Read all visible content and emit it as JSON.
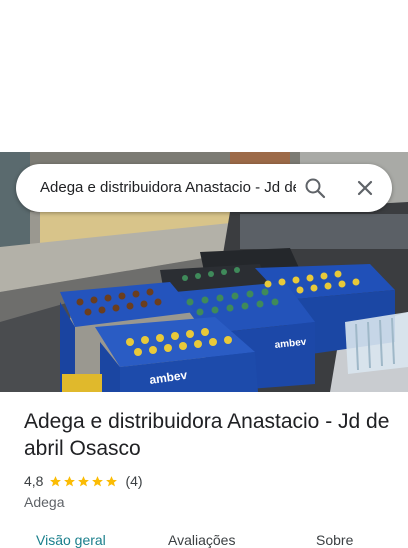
{
  "search": {
    "query": "Adega e distribuidora Anastacio - Jd de abril Osasco",
    "search_icon": "search-icon",
    "close_icon": "close-icon"
  },
  "place": {
    "name": "Adega e distribuidora Anastacio - Jd de abril Osasco",
    "rating": "4,8",
    "rating_value": 4.8,
    "stars_filled": 5,
    "review_count": "(4)",
    "category": "Adega"
  },
  "tabs": [
    {
      "label": "Visão geral",
      "active": true
    },
    {
      "label": "Avaliações",
      "active": false
    },
    {
      "label": "Sobre",
      "active": false
    }
  ],
  "colors": {
    "star": "#fbbc04",
    "active_tab": "#1a7f8c",
    "crate_blue": "#1e4fb5"
  },
  "photo": {
    "crate_brand": "ambev"
  }
}
